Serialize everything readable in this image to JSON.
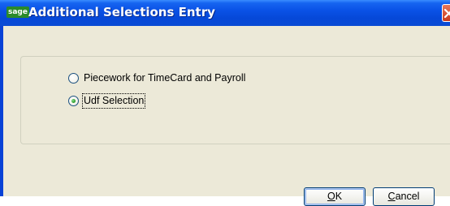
{
  "window": {
    "logo": "sage",
    "title": "Additional Selections Entry"
  },
  "options": [
    {
      "label": "Piecework for TimeCard and Payroll",
      "selected": false
    },
    {
      "label": "Udf Selection",
      "selected": true
    }
  ],
  "buttons": {
    "ok": {
      "accel": "O",
      "rest": "K"
    },
    "cancel": {
      "accel": "C",
      "rest": "ancel"
    }
  },
  "colors": {
    "titlebar": "#0a52e6",
    "close": "#c8391c",
    "dialog_bg": "#ece9d8",
    "radio_selected": "#2fa12f"
  },
  "icons": {
    "close": "close-icon",
    "logo": "sage-logo-icon"
  }
}
